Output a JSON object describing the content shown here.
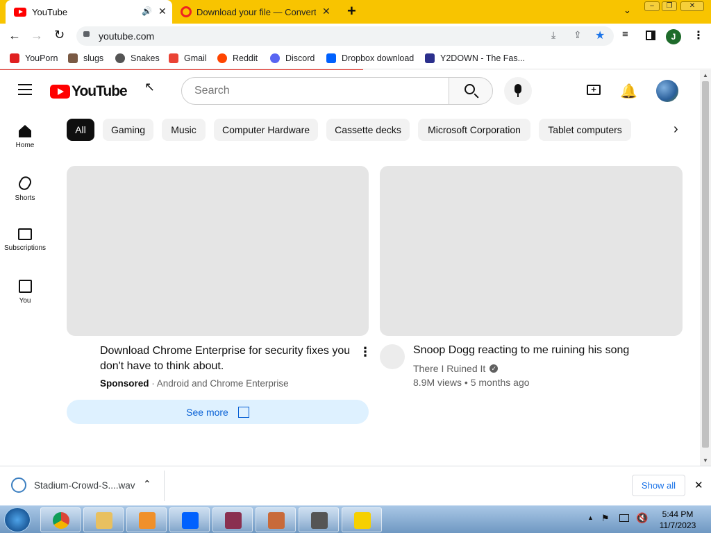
{
  "browser": {
    "tabs": [
      {
        "title": "YouTube",
        "icon": "youtube-icon"
      },
      {
        "title": "Download your file — Convertio",
        "icon": "convertio-icon"
      }
    ],
    "new_tab": "+",
    "url": "youtube.com",
    "profile_initial": "J",
    "bookmarks": [
      {
        "label": "YouPorn",
        "color": "#e02020"
      },
      {
        "label": "slugs",
        "color": "#7a5a44"
      },
      {
        "label": "Snakes",
        "color": "#555555"
      },
      {
        "label": "Gmail",
        "color": "#ea4335"
      },
      {
        "label": "Reddit",
        "color": "#ff4500"
      },
      {
        "label": "Discord",
        "color": "#5865f2"
      },
      {
        "label": "Dropbox download",
        "color": "#0061fe"
      },
      {
        "label": "Y2DOWN - The Fas...",
        "color": "#2b2f8c"
      }
    ]
  },
  "youtube": {
    "logo_text": "YouTube",
    "search_placeholder": "Search",
    "nav": [
      {
        "label": "Home",
        "icon": "home-icon"
      },
      {
        "label": "Shorts",
        "icon": "shorts-icon"
      },
      {
        "label": "Subscriptions",
        "icon": "subscriptions-icon"
      },
      {
        "label": "You",
        "icon": "you-icon"
      }
    ],
    "chips": [
      "All",
      "Gaming",
      "Music",
      "Computer Hardware",
      "Cassette decks",
      "Microsoft Corporation",
      "Tablet computers"
    ],
    "ad": {
      "title": "Download Chrome Enterprise for security fixes you don't have to think about.",
      "sponsored": "Sponsored",
      "advertiser": "· Android and Chrome Enterprise",
      "cta": "See more"
    },
    "video": {
      "title": "Snoop Dogg reacting to me ruining his song",
      "channel": "There I Ruined It",
      "meta": "8.9M views • 5 months ago"
    }
  },
  "downloads": {
    "file": "Stadium-Crowd-S....wav",
    "show_all": "Show all"
  },
  "taskbar": {
    "time": "5:44 PM",
    "date": "11/7/2023",
    "apps": [
      "chrome-icon",
      "explorer-icon",
      "media-player-icon",
      "dropbox-icon",
      "winrar-icon",
      "firefox-like-icon",
      "tool-icon",
      "notes-icon"
    ]
  }
}
